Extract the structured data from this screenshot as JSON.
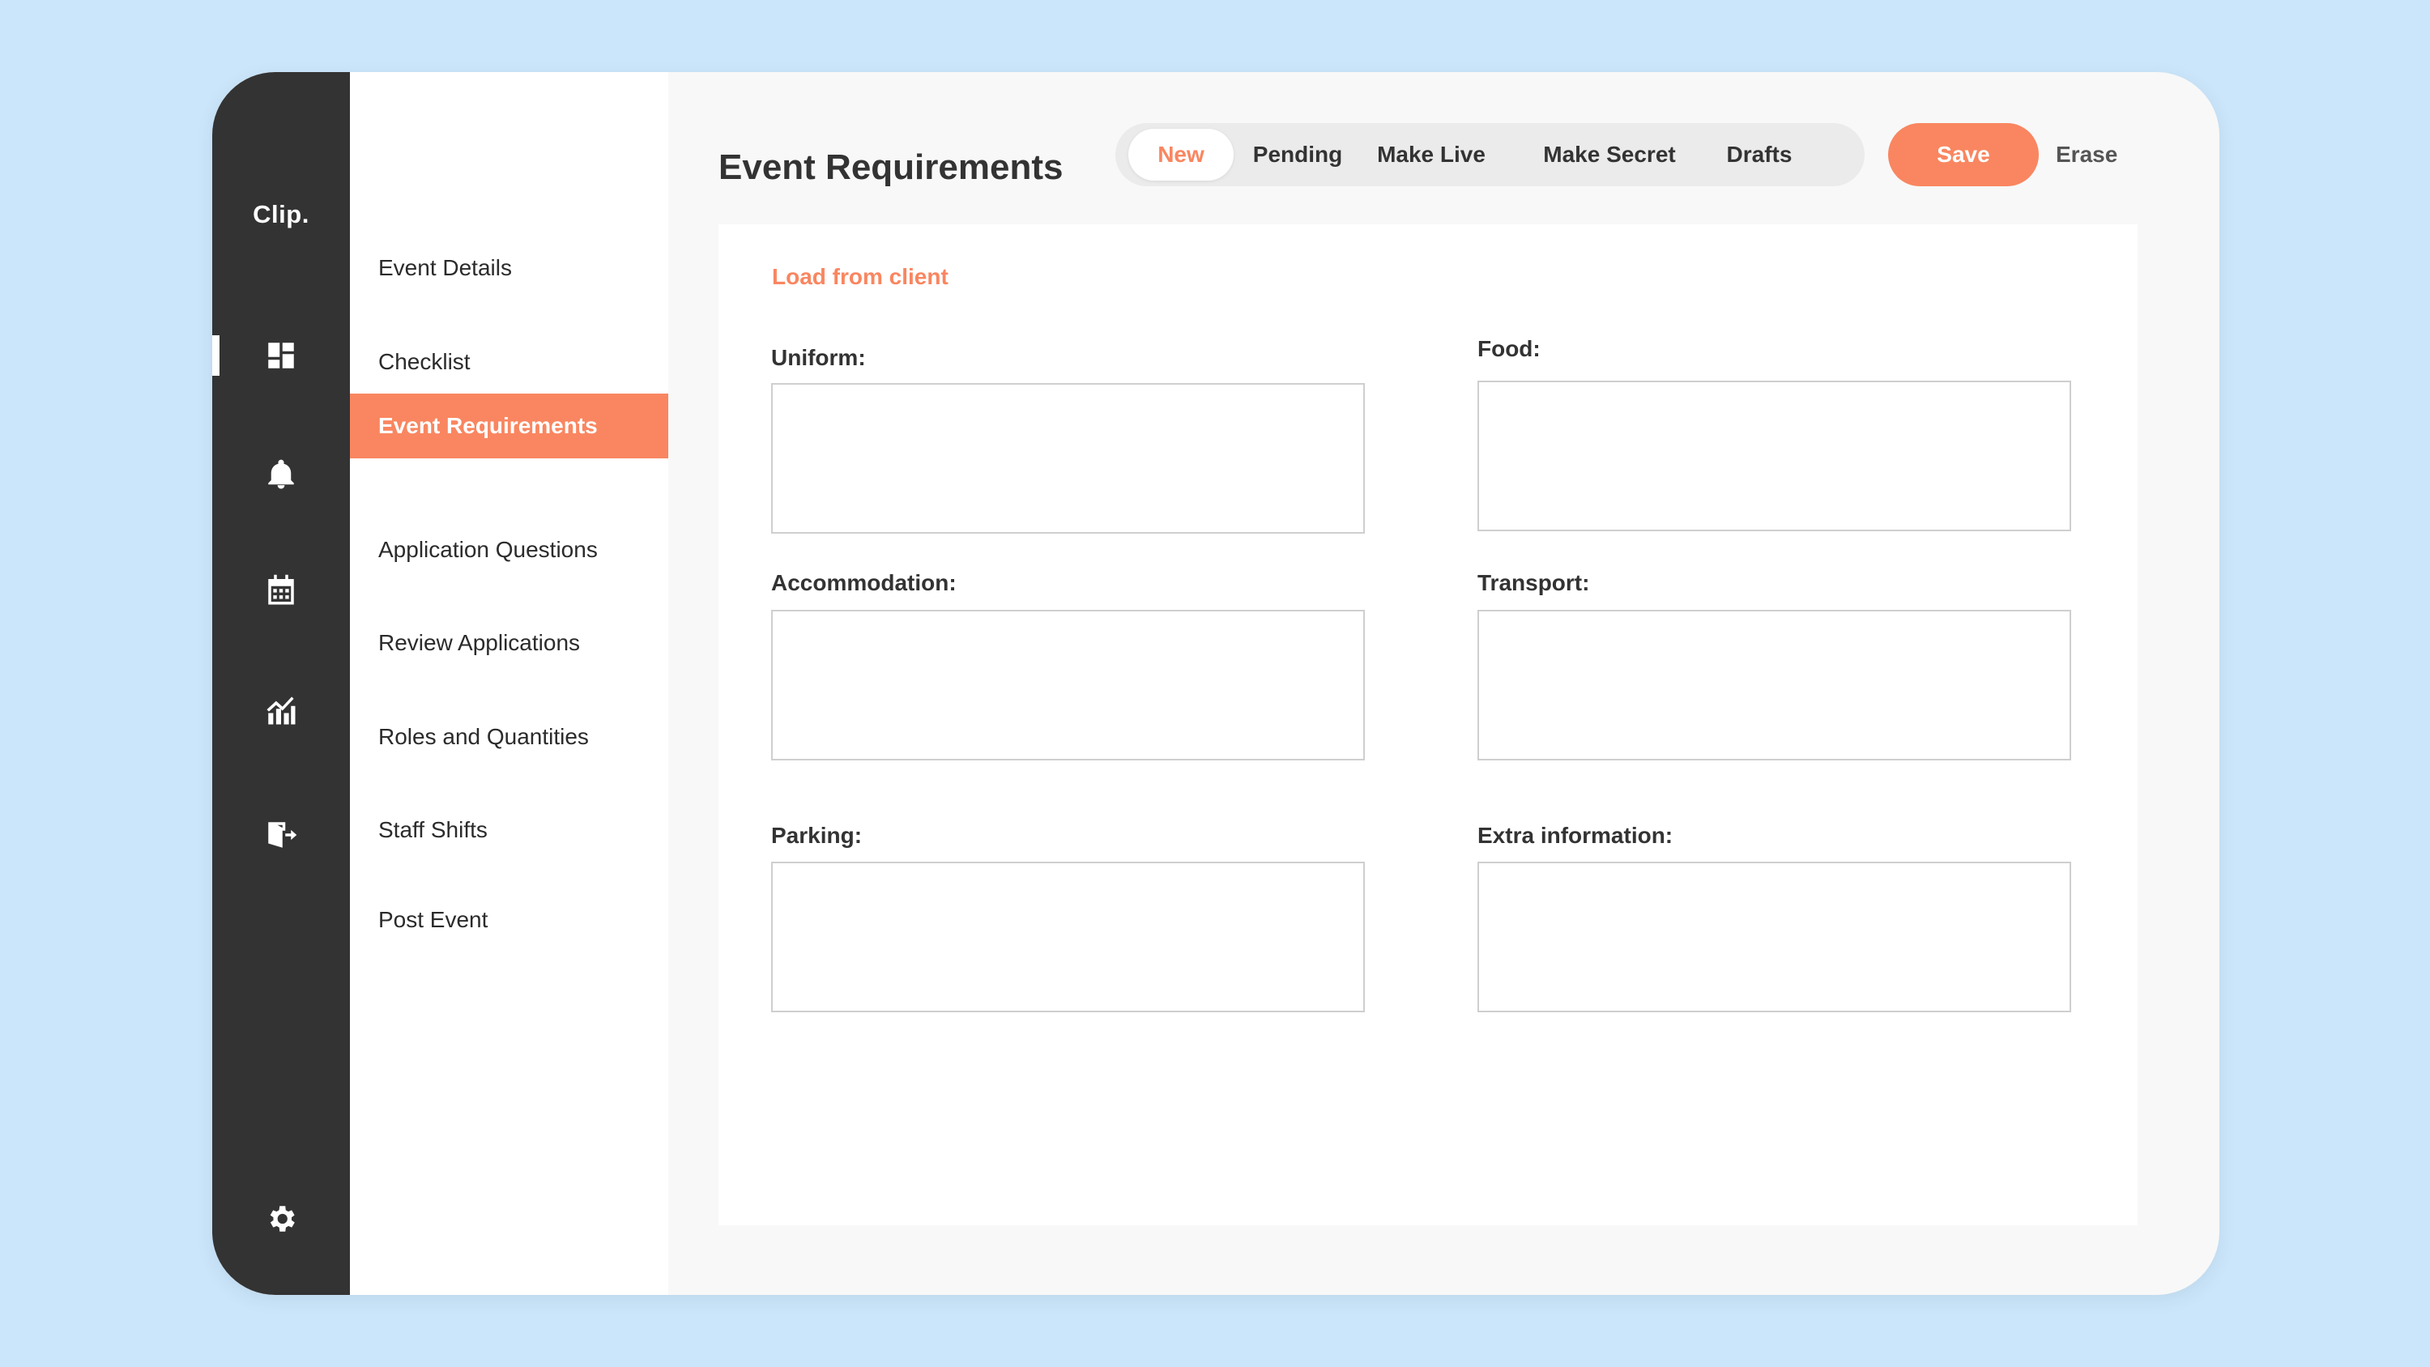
{
  "app": {
    "logo": "Clip."
  },
  "rail": {
    "items": [
      {
        "icon": "dashboard-icon"
      },
      {
        "icon": "bell-icon"
      },
      {
        "icon": "calendar-icon"
      },
      {
        "icon": "analytics-icon"
      },
      {
        "icon": "logout-icon"
      },
      {
        "icon": "gear-icon"
      }
    ]
  },
  "subnav": {
    "items": [
      {
        "label": "Event Details"
      },
      {
        "label": "Checklist"
      },
      {
        "label": "Event Requirements",
        "active": true
      },
      {
        "label": "Application Questions"
      },
      {
        "label": "Review Applications"
      },
      {
        "label": "Roles and Quantities"
      },
      {
        "label": "Staff Shifts"
      },
      {
        "label": "Post Event"
      }
    ]
  },
  "header": {
    "title": "Event Requirements",
    "tabs": [
      {
        "label": "New",
        "active": true
      },
      {
        "label": "Pending"
      },
      {
        "label": "Make Live"
      },
      {
        "label": "Make Secret"
      },
      {
        "label": "Drafts"
      }
    ],
    "save_label": "Save",
    "erase_label": "Erase"
  },
  "form": {
    "load_link": "Load from client",
    "fields": [
      {
        "label": "Uniform:",
        "value": ""
      },
      {
        "label": "Food:",
        "value": ""
      },
      {
        "label": "Accommodation:",
        "value": ""
      },
      {
        "label": "Transport:",
        "value": ""
      },
      {
        "label": "Parking:",
        "value": ""
      },
      {
        "label": "Extra information:",
        "value": ""
      }
    ]
  },
  "colors": {
    "accent": "#f98660",
    "rail": "#333333",
    "background": "#cbe6fb"
  }
}
